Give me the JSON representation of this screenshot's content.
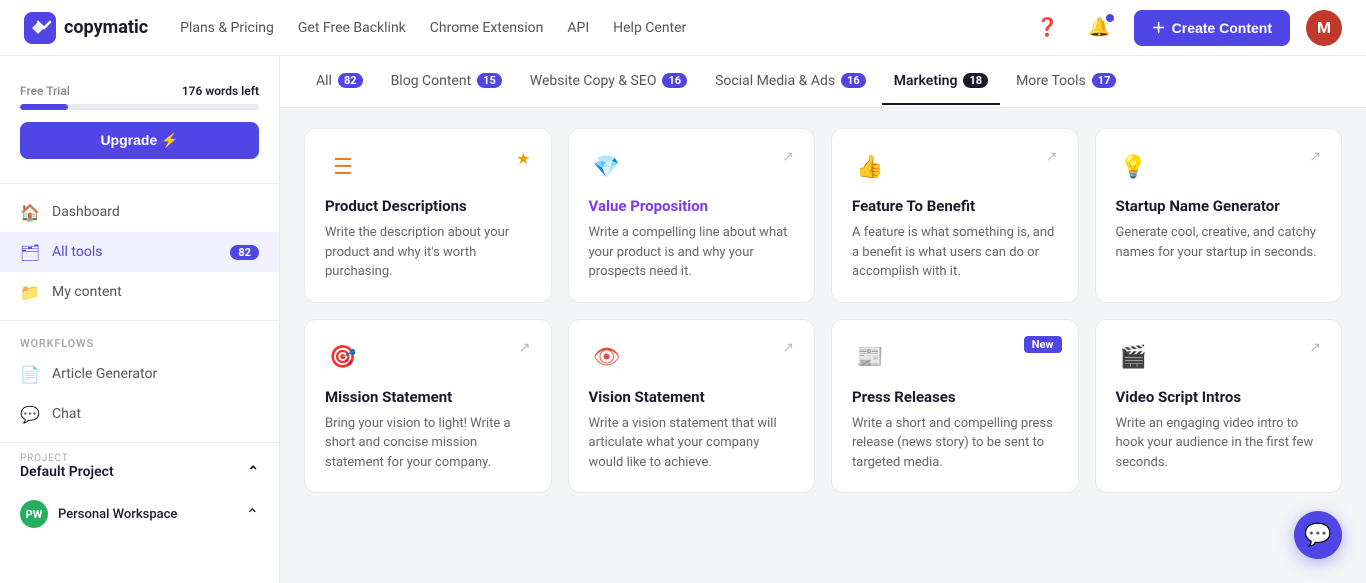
{
  "brand": {
    "name": "copymatic"
  },
  "topnav": {
    "links": [
      {
        "id": "plans",
        "label": "Plans & Pricing"
      },
      {
        "id": "backlink",
        "label": "Get Free Backlink"
      },
      {
        "id": "chrome",
        "label": "Chrome Extension"
      },
      {
        "id": "api",
        "label": "API"
      },
      {
        "id": "help",
        "label": "Help Center"
      }
    ],
    "create_btn": "Create Content",
    "avatar_letter": "M"
  },
  "sidebar": {
    "free_trial_label": "Free Trial",
    "words_left": "176 words left",
    "upgrade_btn": "Upgrade ⚡",
    "progress_pct": 20,
    "nav_items": [
      {
        "id": "dashboard",
        "icon": "🏠",
        "label": "Dashboard"
      },
      {
        "id": "all-tools",
        "icon": "🗂",
        "label": "All tools",
        "badge": "82",
        "active": true
      },
      {
        "id": "my-content",
        "icon": "📁",
        "label": "My content"
      }
    ],
    "workflows_label": "Workflows",
    "workflow_items": [
      {
        "id": "article-gen",
        "icon": "📄",
        "label": "Article Generator"
      },
      {
        "id": "chat",
        "icon": "💬",
        "label": "Chat"
      }
    ],
    "project_label": "PROJECT",
    "project_name": "Default Project",
    "personal_initials": "PW",
    "personal_label": "Personal Workspace"
  },
  "tabs": [
    {
      "id": "all",
      "label": "All",
      "badge": "82",
      "active": false
    },
    {
      "id": "blog",
      "label": "Blog Content",
      "badge": "15",
      "active": false
    },
    {
      "id": "website",
      "label": "Website Copy & SEO",
      "badge": "16",
      "active": false
    },
    {
      "id": "social",
      "label": "Social Media & Ads",
      "badge": "16",
      "active": false
    },
    {
      "id": "marketing",
      "label": "Marketing",
      "badge": "18",
      "active": true
    },
    {
      "id": "more",
      "label": "More Tools",
      "badge": "17",
      "active": false
    }
  ],
  "cards": [
    {
      "id": "product-desc",
      "icon": "☰",
      "icon_color": "#e67e22",
      "starred": true,
      "title": "Product Descriptions",
      "title_highlight": false,
      "desc": "Write the description about your product and why it's worth purchasing.",
      "new_badge": false
    },
    {
      "id": "value-prop",
      "icon": "💎",
      "icon_color": "#e74c3c",
      "starred": false,
      "title": "Value Proposition",
      "title_highlight": true,
      "desc": "Write a compelling line about what your product is and why your prospects need it.",
      "new_badge": false
    },
    {
      "id": "feature-benefit",
      "icon": "👍",
      "icon_color": "#e67e22",
      "starred": false,
      "title": "Feature To Benefit",
      "title_highlight": false,
      "desc": "A feature is what something is, and a benefit is what users can do or accomplish with it.",
      "new_badge": false
    },
    {
      "id": "startup-name",
      "icon": "💡",
      "icon_color": "#f39c12",
      "starred": false,
      "title": "Startup Name Generator",
      "title_highlight": false,
      "desc": "Generate cool, creative, and catchy names for your startup in seconds.",
      "new_badge": false
    },
    {
      "id": "mission",
      "icon": "🎯",
      "icon_color": "#e67e22",
      "starred": false,
      "title": "Mission Statement",
      "title_highlight": false,
      "desc": "Bring your vision to light! Write a short and concise mission statement for your company.",
      "new_badge": false
    },
    {
      "id": "vision",
      "icon": "👁",
      "icon_color": "#e74c3c",
      "starred": false,
      "title": "Vision Statement",
      "title_highlight": false,
      "desc": "Write a vision statement that will articulate what your company would like to achieve.",
      "new_badge": false
    },
    {
      "id": "press-releases",
      "icon": "📰",
      "icon_color": "#7f8c8d",
      "starred": false,
      "title": "Press Releases",
      "title_highlight": false,
      "desc": "Write a short and compelling press release (news story) to be sent to targeted media.",
      "new_badge": true
    },
    {
      "id": "video-script",
      "icon": "🎬",
      "icon_color": "#e67e22",
      "starred": false,
      "title": "Video Script Intros",
      "title_highlight": false,
      "desc": "Write an engaging video intro to hook your audience in the first few seconds.",
      "new_badge": false
    }
  ]
}
